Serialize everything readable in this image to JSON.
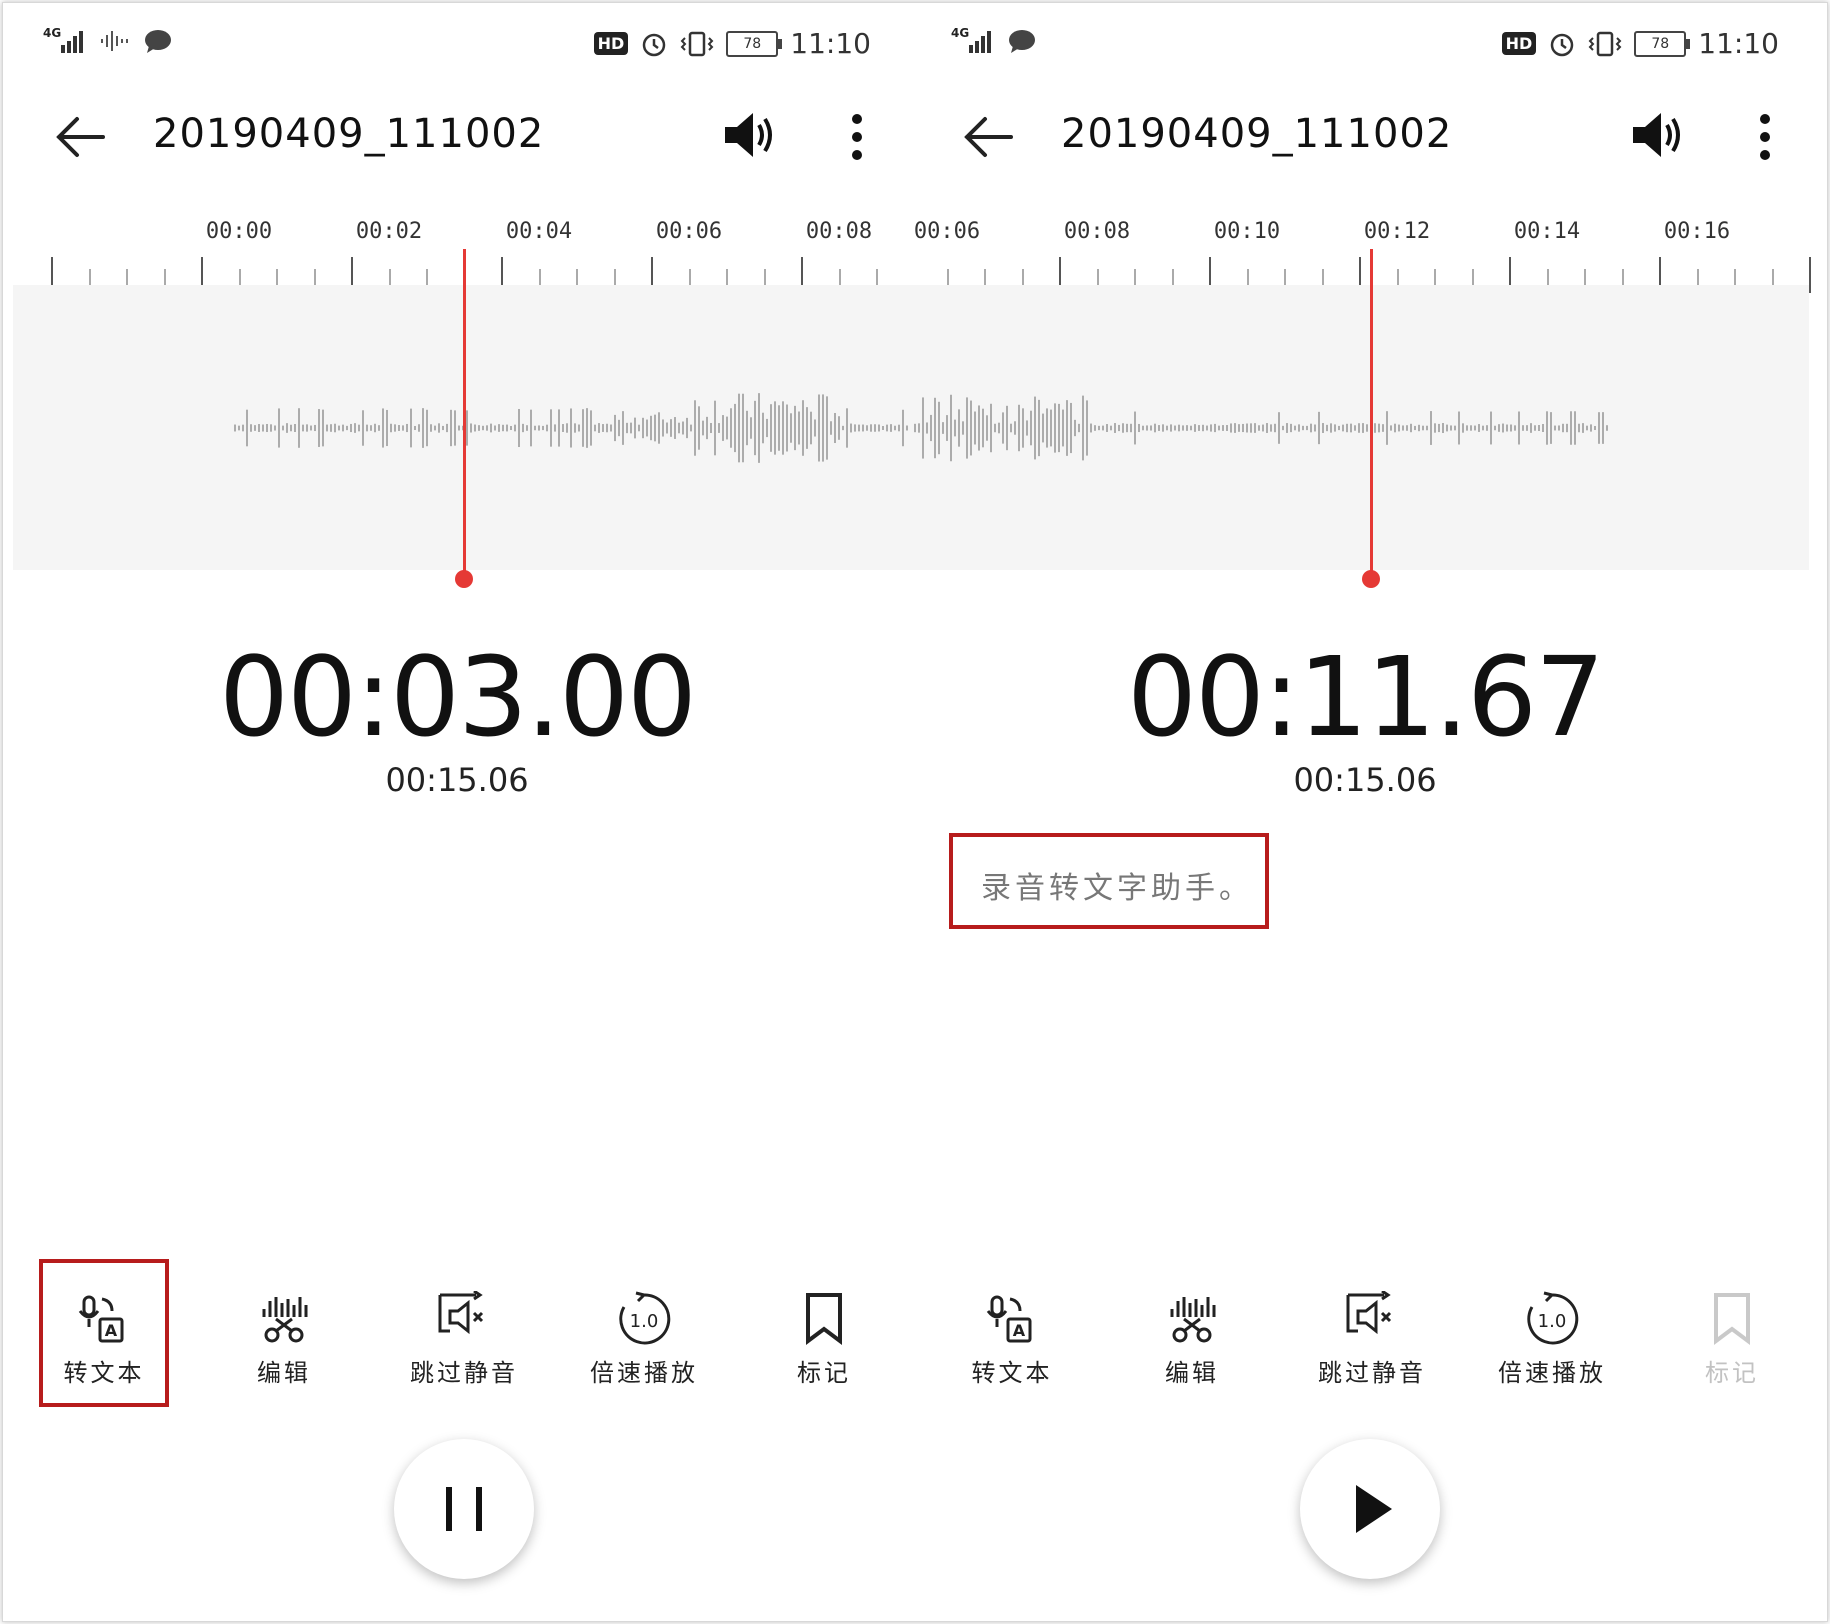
{
  "left": {
    "status": {
      "signal": "4G",
      "battery": "78",
      "time": "11:10",
      "hd": "HD"
    },
    "title": "20190409_111002",
    "timeline": [
      "00:00",
      "00:02",
      "00:04",
      "00:06",
      "00:08"
    ],
    "current_time": "00:03.00",
    "total_time": "00:15.06",
    "tools": {
      "to_text": "转文本",
      "edit": "编辑",
      "skip_silence": "跳过静音",
      "speed": "倍速播放",
      "mark": "标记"
    },
    "speed_value": "1.0"
  },
  "right": {
    "status": {
      "signal": "4G",
      "battery": "78",
      "time": "11:10",
      "hd": "HD"
    },
    "title": "20190409_111002",
    "timeline": [
      "00:06",
      "00:08",
      "00:10",
      "00:12",
      "00:14",
      "00:16"
    ],
    "current_time": "00:11.67",
    "total_time": "00:15.06",
    "transcript": "录音转文字助手。",
    "tools": {
      "to_text": "转文本",
      "edit": "编辑",
      "skip_silence": "跳过静音",
      "speed": "倍速播放",
      "mark": "标记"
    },
    "speed_value": "1.0"
  },
  "colors": {
    "accent": "#e53935",
    "highlight": "#b71c1c",
    "wave": "#9a9a9a"
  }
}
